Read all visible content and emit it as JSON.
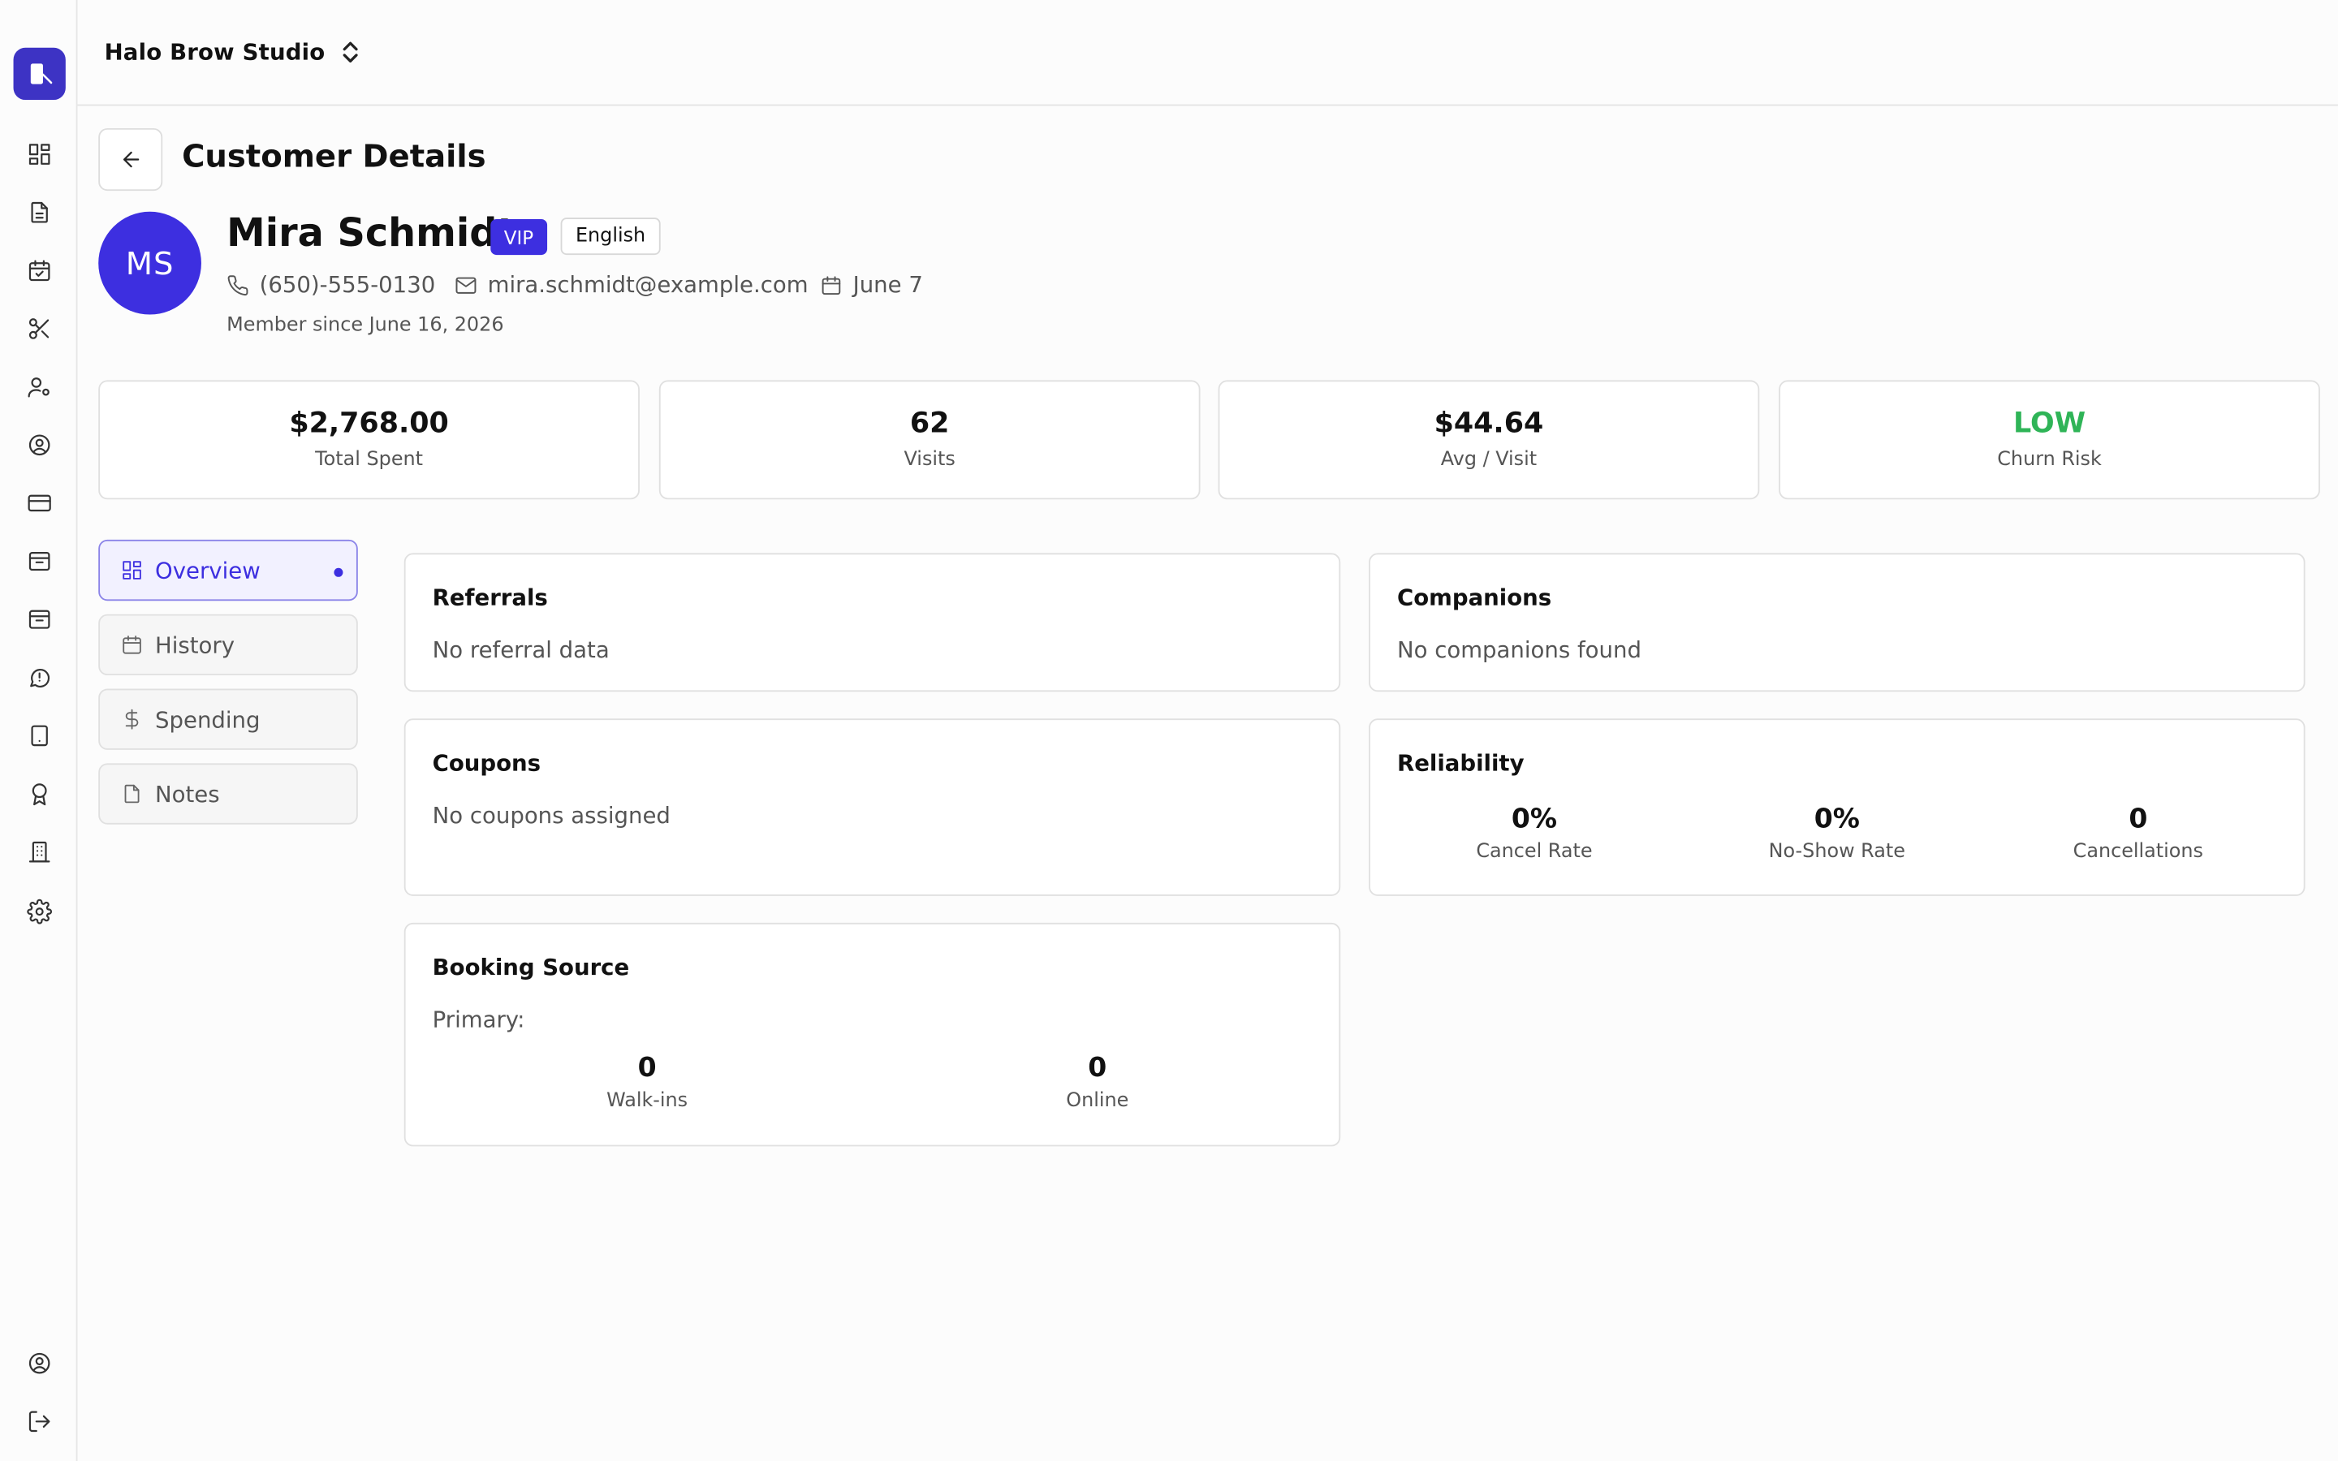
{
  "app": {
    "studio_name": "Halo Brow Studio"
  },
  "rail": {
    "icons": [
      "logo-icon",
      "dashboard-icon",
      "document-icon",
      "calendar-icon",
      "scissors-icon",
      "user-settings-icon",
      "user-circle-icon",
      "credit-card-icon",
      "inbox-icon",
      "archive-icon",
      "message-icon",
      "tablet-icon",
      "award-icon",
      "building-icon",
      "settings-icon",
      "account-icon",
      "logout-icon"
    ]
  },
  "page": {
    "title": "Customer Details"
  },
  "customer": {
    "initials": "MS",
    "name": "Mira Schmidt",
    "vip_badge": "VIP",
    "language_badge": "English",
    "phone": "(650)-555-0130",
    "email": "mira.schmidt@example.com",
    "birthday": "June 7",
    "member_since": "Member since June 16, 2026"
  },
  "stats": [
    {
      "value": "$2,768.00",
      "label": "Total Spent"
    },
    {
      "value": "62",
      "label": "Visits"
    },
    {
      "value": "$44.64",
      "label": "Avg / Visit"
    },
    {
      "value": "LOW",
      "label": "Churn Risk",
      "color": "#2fb457"
    }
  ],
  "tabs": [
    {
      "label": "Overview",
      "active": true
    },
    {
      "label": "History"
    },
    {
      "label": "Spending"
    },
    {
      "label": "Notes"
    }
  ],
  "cards": {
    "referrals": {
      "title": "Referrals",
      "body": "No referral data"
    },
    "companions": {
      "title": "Companions",
      "body": "No companions found"
    },
    "coupons": {
      "title": "Coupons",
      "body": "No coupons assigned"
    },
    "reliability": {
      "title": "Reliability",
      "metrics": [
        {
          "value": "0%",
          "label": "Cancel Rate"
        },
        {
          "value": "0%",
          "label": "No-Show Rate"
        },
        {
          "value": "0",
          "label": "Cancellations"
        }
      ]
    },
    "booking_source": {
      "title": "Booking Source",
      "primary_label": "Primary:",
      "metrics": [
        {
          "value": "0",
          "label": "Walk-ins"
        },
        {
          "value": "0",
          "label": "Online"
        }
      ]
    }
  },
  "colors": {
    "accent": "#3d2fe0",
    "success": "#2fb457"
  }
}
